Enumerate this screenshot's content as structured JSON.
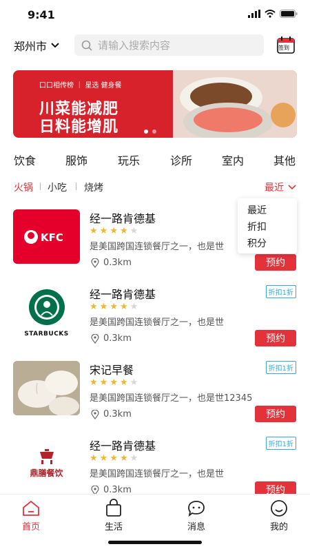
{
  "status": {
    "time": "9:41"
  },
  "header": {
    "city": "郑州市",
    "search_placeholder": "请输入搜索内容",
    "checkin_label": "签到"
  },
  "banner": {
    "small_text": "口口相传榜 ｜ 星选 健身餐",
    "line1": "川菜能减肥",
    "line2": "日料能增肌"
  },
  "categories": [
    "饮食",
    "服饰",
    "玩乐",
    "诊所",
    "室内",
    "其他"
  ],
  "sub_tabs": [
    "火锅",
    "小吃",
    "烧烤"
  ],
  "sort": {
    "label": "最近",
    "options": [
      "最近",
      "折扣",
      "积分"
    ]
  },
  "shops": [
    {
      "name": "经一路肯德基",
      "rating": 4,
      "desc": "是美国跨国连锁餐厅之一，也是世",
      "distance": "0.3km",
      "discount": "",
      "book": "预约",
      "logo": "kfc-logo"
    },
    {
      "name": "经一路肯德基",
      "rating": 4,
      "desc": "是美国跨国连锁餐厅之一，也是世",
      "distance": "0.3km",
      "discount": "折扣1折",
      "book": "预约",
      "logo": "starbucks-logo",
      "logo_text": "STARBUCKS"
    },
    {
      "name": "宋记早餐",
      "rating": 4,
      "desc": "是美国跨国连锁餐厅之一，也是世12345",
      "distance": "0.3km",
      "discount": "折扣1折",
      "book": "预约",
      "logo": "steamed-buns-photo"
    },
    {
      "name": "经一路肯德基",
      "rating": 4,
      "desc": "是美国跨国连锁餐厅之一，也是世",
      "distance": "0.3km",
      "discount": "折扣1折",
      "book": "预约",
      "logo": "dingshan-logo",
      "logo_text": "鼎膳餐饮"
    }
  ],
  "tab_bar": [
    {
      "label": "首页",
      "icon": "home-icon",
      "active": true
    },
    {
      "label": "生活",
      "icon": "bag-icon",
      "active": false
    },
    {
      "label": "消息",
      "icon": "chat-icon",
      "active": false
    },
    {
      "label": "我的",
      "icon": "smile-icon",
      "active": false
    }
  ],
  "colors": {
    "accent": "#e4323a",
    "star": "#f3b52d",
    "discount": "#3aa6d9"
  }
}
